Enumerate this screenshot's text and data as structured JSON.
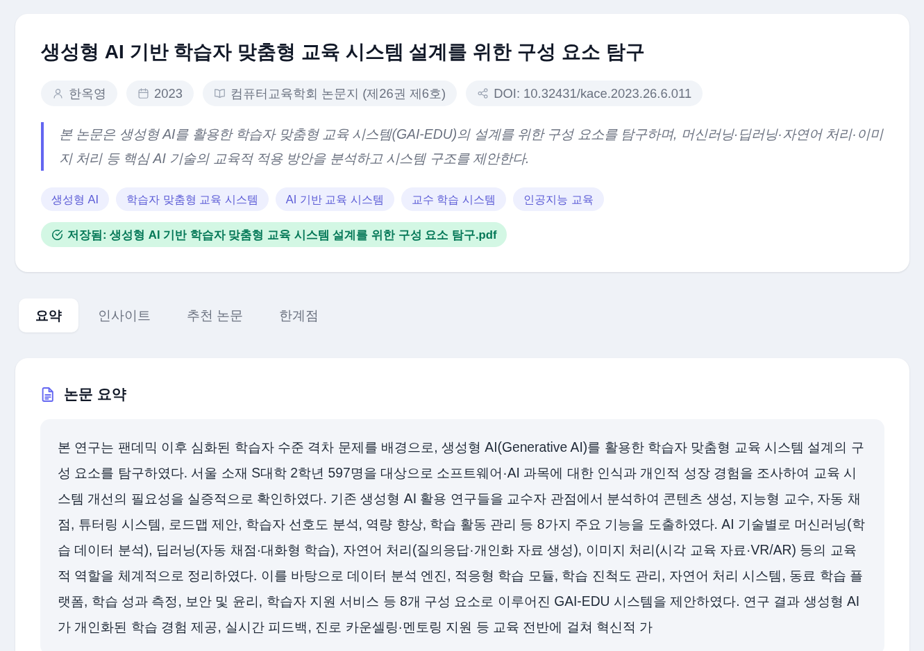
{
  "paper": {
    "title": "생성형 AI 기반 학습자 맞춤형 교육 시스템 설계를 위한 구성 요소 탐구",
    "meta": [
      {
        "kind": "author",
        "text": "한옥영"
      },
      {
        "kind": "year",
        "text": "2023"
      },
      {
        "kind": "journal",
        "text": "컴퓨터교육학회 논문지 (제26권 제6호)"
      },
      {
        "kind": "doi",
        "text": "DOI: 10.32431/kace.2023.26.6.011"
      }
    ],
    "abstract": "본 논문은 생성형 AI를 활용한 학습자 맞춤형 교육 시스템(GAI-EDU)의 설계를 위한 구성 요소를 탐구하며, 머신러닝·딥러닝·자연어 처리·이미지 처리 등 핵심 AI 기술의 교육적 적용 방안을 분석하고 시스템 구조를 제안한다.",
    "keywords": [
      "생성형 AI",
      "학습자 맞춤형 교육 시스템",
      "AI 기반 교육 시스템",
      "교수 학습 시스템",
      "인공지능 교육"
    ],
    "saved_notice": "저장됨: 생성형 AI 기반 학습자 맞춤형 교육 시스템 설계를 위한 구성 요소 탐구.pdf"
  },
  "tabs": [
    {
      "label": "요약",
      "selected": true
    },
    {
      "label": "인사이트",
      "selected": false
    },
    {
      "label": "추천 논문",
      "selected": false
    },
    {
      "label": "한계점",
      "selected": false
    }
  ],
  "summary_section": {
    "heading": "논문 요약",
    "text": "본 연구는 팬데믹 이후 심화된 학습자 수준 격차 문제를 배경으로, 생성형 AI(Generative AI)를 활용한 학습자 맞춤형 교육 시스템 설계의 구성 요소를 탐구하였다. 서울 소재 S대학 2학년 597명을 대상으로 소프트웨어·AI 과목에 대한 인식과 개인적 성장 경험을 조사하여 교육 시스템 개선의 필요성을 실증적으로 확인하였다. 기존 생성형 AI 활용 연구들을 교수자 관점에서 분석하여 콘텐츠 생성, 지능형 교수, 자동 채점, 튜터링 시스템, 로드맵 제안, 학습자 선호도 분석, 역량 향상, 학습 활동 관리 등 8가지 주요 기능을 도출하였다. AI 기술별로 머신러닝(학습 데이터 분석), 딥러닝(자동 채점·대화형 학습), 자연어 처리(질의응답·개인화 자료 생성), 이미지 처리(시각 교육 자료·VR/AR) 등의 교육적 역할을 체계적으로 정리하였다. 이를 바탕으로 데이터 분석 엔진, 적응형 학습 모듈, 학습 진척도 관리, 자연어 처리 시스템, 동료 학습 플랫폼, 학습 성과 측정, 보안 및 윤리, 학습자 지원 서비스 등 8개 구성 요소로 이루어진 GAI-EDU 시스템을 제안하였다. 연구 결과 생성형 AI가 개인화된 학습 경험 제공, 실시간 피드백, 진로 카운셀링·멘토링 지원 등 교육 전반에 걸쳐 혁신적 가"
  }
}
